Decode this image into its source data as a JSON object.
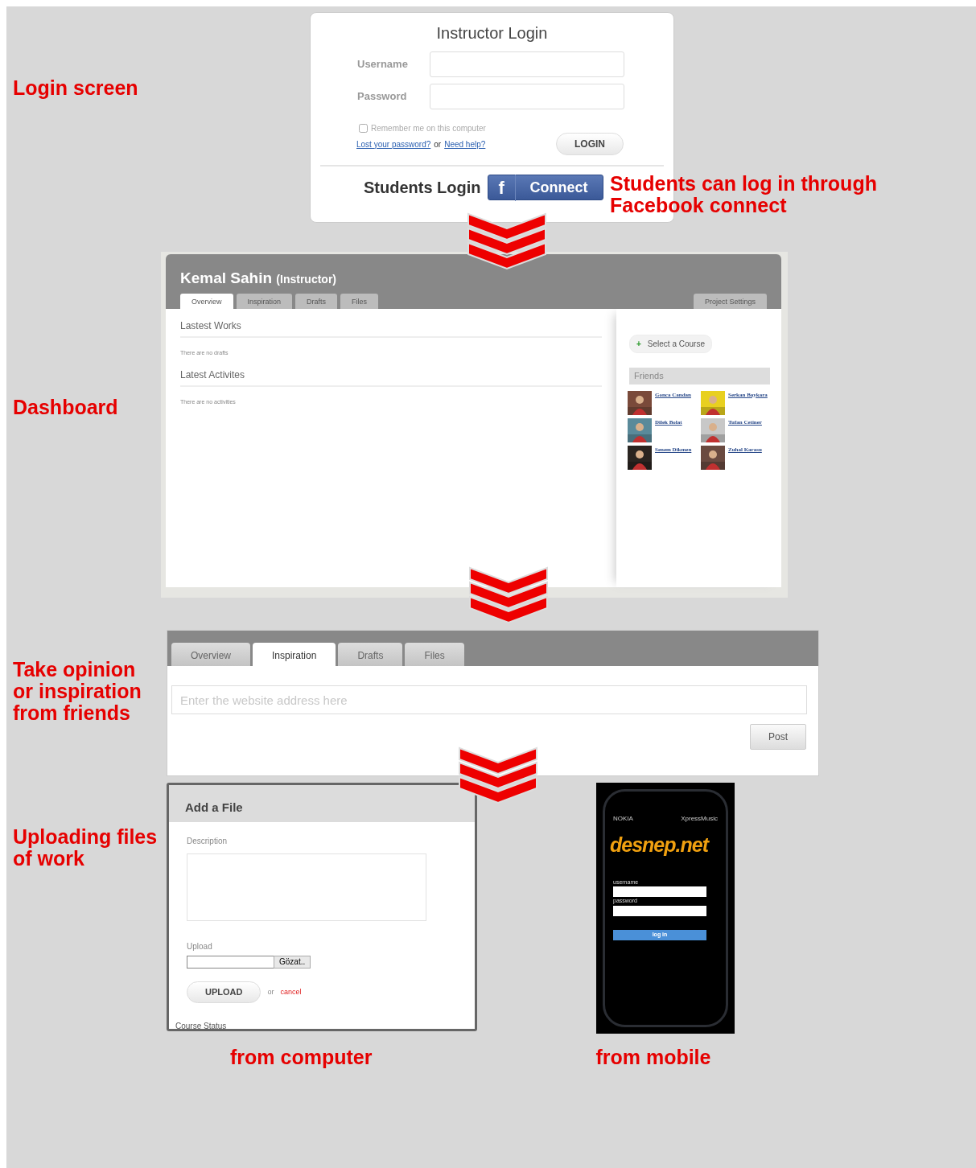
{
  "login_section": {
    "caption": "Login screen",
    "login_box": {
      "title": "Instructor Login",
      "fields": [
        {
          "label": "Username"
        },
        {
          "label": "Password"
        }
      ],
      "remember": {
        "label": "Remember me on this computer",
        "checked": false
      },
      "links": [
        "Lost your password?",
        "Need help?"
      ],
      "or_text": "or",
      "login_button": "LOGIN",
      "students_label": "Students Login",
      "facebook_button": {
        "icon": "f",
        "label": "Connect"
      }
    },
    "note": "Students can log in through Facebook connect"
  },
  "dashboard_section": {
    "caption": "Dashboard",
    "user_name": "Kemal Sahin",
    "role": "(Instructor)",
    "tabs": [
      {
        "label": "Overview",
        "selected": true
      },
      {
        "label": "Inspiration",
        "selected": false
      },
      {
        "label": "Drafts",
        "selected": false
      },
      {
        "label": "Files",
        "selected": false
      }
    ],
    "settings_tab": "Project Settings",
    "sections": [
      {
        "title": "Lastest Works",
        "empty_text": "There are no drafts"
      },
      {
        "title": "Latest Activites",
        "empty_text": "There are no activities"
      }
    ],
    "course_button": {
      "icon": "+",
      "label": "Select a Course"
    },
    "friends_title": "Friends",
    "friends": [
      {
        "name": "Gonca Candan",
        "color": "#7a4a3a"
      },
      {
        "name": "Serkan Baykara",
        "color": "#e8d020"
      },
      {
        "name": "Dilek Bolat",
        "color": "#5a8a9a"
      },
      {
        "name": "Tufan Cetiner",
        "color": "#c8c8c8"
      },
      {
        "name": "Senem Dikmen",
        "color": "#2a2420"
      },
      {
        "name": "Zuhal Karasu",
        "color": "#6a4a40"
      }
    ]
  },
  "inspiration_section": {
    "caption": "Take opinion or inspiration from friends",
    "tabs": [
      {
        "label": "Overview",
        "selected": false
      },
      {
        "label": "Inspiration",
        "selected": true
      },
      {
        "label": "Drafts",
        "selected": false
      },
      {
        "label": "Files",
        "selected": false
      }
    ],
    "placeholder": "Enter the website address here",
    "post_button": "Post"
  },
  "upload_section": {
    "caption": "Uploading files of work",
    "dialog": {
      "title": "Add a File",
      "description_label": "Description",
      "upload_label": "Upload",
      "browse_button": "Gözat..",
      "upload_button": "UPLOAD",
      "or_text": "or",
      "cancel_link": "cancel",
      "footer_text": "Course Status"
    },
    "mobile": {
      "brand": "NOKIA",
      "app": "XpressMusic",
      "logo": "desnep.net",
      "fields": [
        {
          "label": "username"
        },
        {
          "label": "password"
        }
      ],
      "login_button": "log in"
    },
    "captions": [
      "from computer",
      "from mobile"
    ]
  }
}
